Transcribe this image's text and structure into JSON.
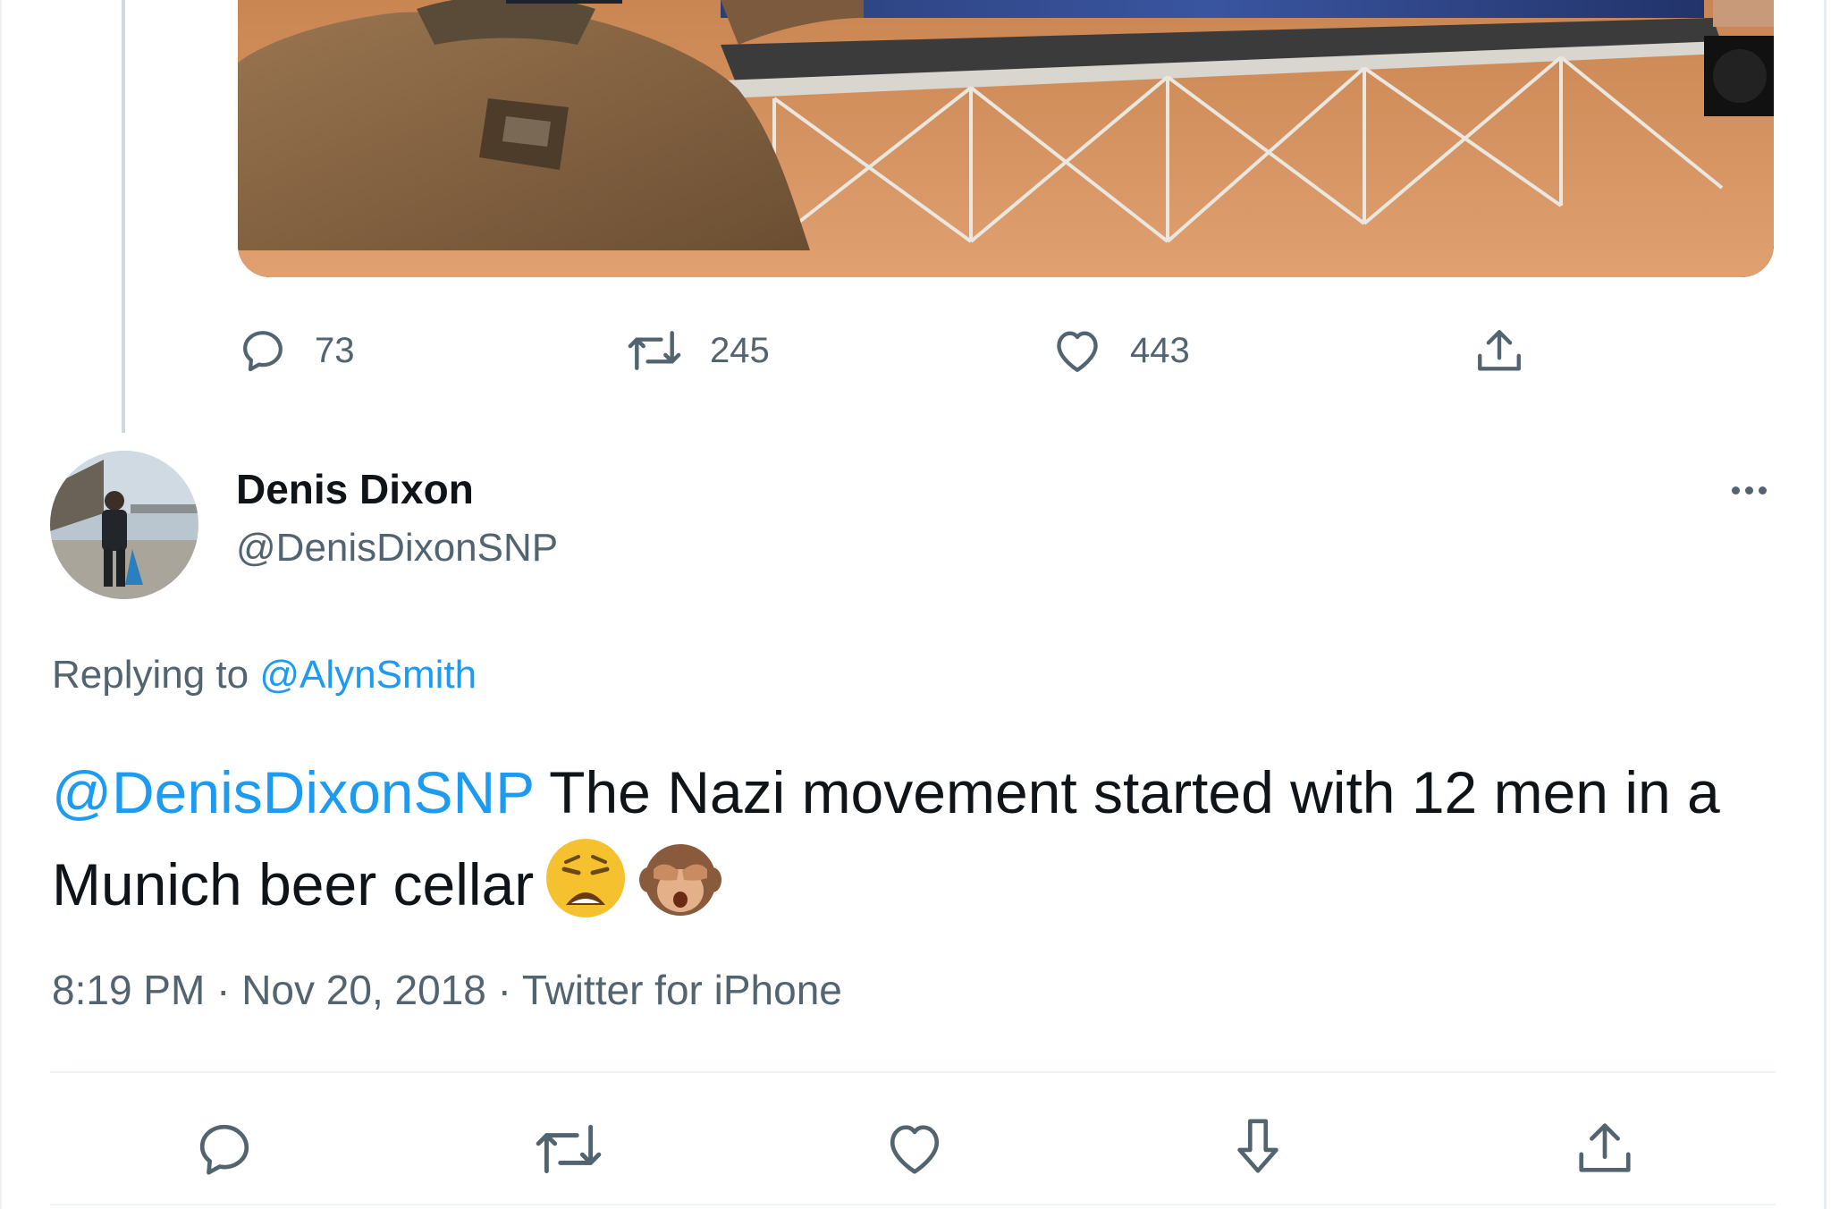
{
  "parent_tweet": {
    "media": {
      "description_icon": "photo"
    },
    "actions": {
      "reply_count": "73",
      "retweet_count": "245",
      "like_count": "443"
    }
  },
  "reply_tweet": {
    "author": {
      "display_name": "Denis Dixon",
      "handle": "@DenisDixonSNP"
    },
    "replying_to_prefix": "Replying to",
    "replying_to_handle": "@AlynSmith",
    "text_mention": "@DenisDixonSNP",
    "text_body": " The Nazi movement started with 12 men in a Munich beer cellar",
    "emojis": [
      "weary-face",
      "see-no-evil-monkey"
    ],
    "time": "8:19 PM",
    "date": "Nov 20, 2018",
    "source": "Twitter for iPhone",
    "separator": " · "
  },
  "colors": {
    "link": "#1d9bf0",
    "secondary_text": "#536471",
    "primary_text": "#0f1419",
    "border": "#eff3f4"
  },
  "icons": {
    "reply": "reply-icon",
    "retweet": "retweet-icon",
    "like": "heart-icon",
    "share": "share-icon",
    "bookmark": "bookmark-download-icon",
    "more": "more-icon"
  }
}
